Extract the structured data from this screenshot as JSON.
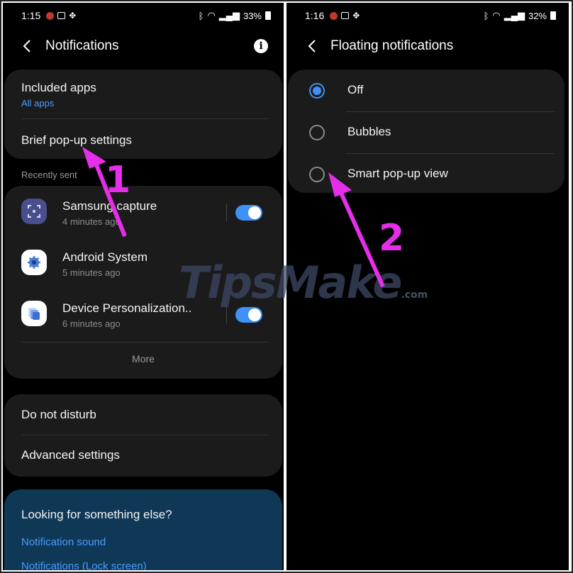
{
  "left": {
    "status": {
      "time": "1:15",
      "battery": "33%"
    },
    "title": "Notifications",
    "included_apps": {
      "label": "Included apps",
      "value": "All apps"
    },
    "brief_popup": "Brief pop-up settings",
    "recently_sent_label": "Recently sent",
    "apps": [
      {
        "name": "Samsung capture",
        "time": "4 minutes ago",
        "toggle_on": true,
        "icon": "samsung-capture-icon",
        "color": "#4a4e8c"
      },
      {
        "name": "Android System",
        "time": "5 minutes ago",
        "toggle_on": false,
        "icon": "android-system-icon",
        "color": "#ffffff"
      },
      {
        "name": "Device Personalization..",
        "time": "6 minutes ago",
        "toggle_on": true,
        "icon": "device-personalization-icon",
        "color": "#ffffff"
      }
    ],
    "more": "More",
    "do_not_disturb": "Do not disturb",
    "advanced": "Advanced settings",
    "looking": {
      "question": "Looking for something else?",
      "links": [
        "Notification sound",
        "Notifications (Lock screen)"
      ]
    }
  },
  "right": {
    "status": {
      "time": "1:16",
      "battery": "32%"
    },
    "title": "Floating notifications",
    "options": [
      {
        "label": "Off",
        "selected": true
      },
      {
        "label": "Bubbles",
        "selected": false
      },
      {
        "label": "Smart pop-up view",
        "selected": false
      }
    ]
  },
  "annotations": {
    "step1": "1",
    "step2": "2"
  },
  "watermark": {
    "text": "TipsMake",
    "suffix": ".com"
  },
  "colors": {
    "accent": "#3e91f7",
    "annotation": "#e52ee8",
    "card": "#1b1b1b"
  }
}
